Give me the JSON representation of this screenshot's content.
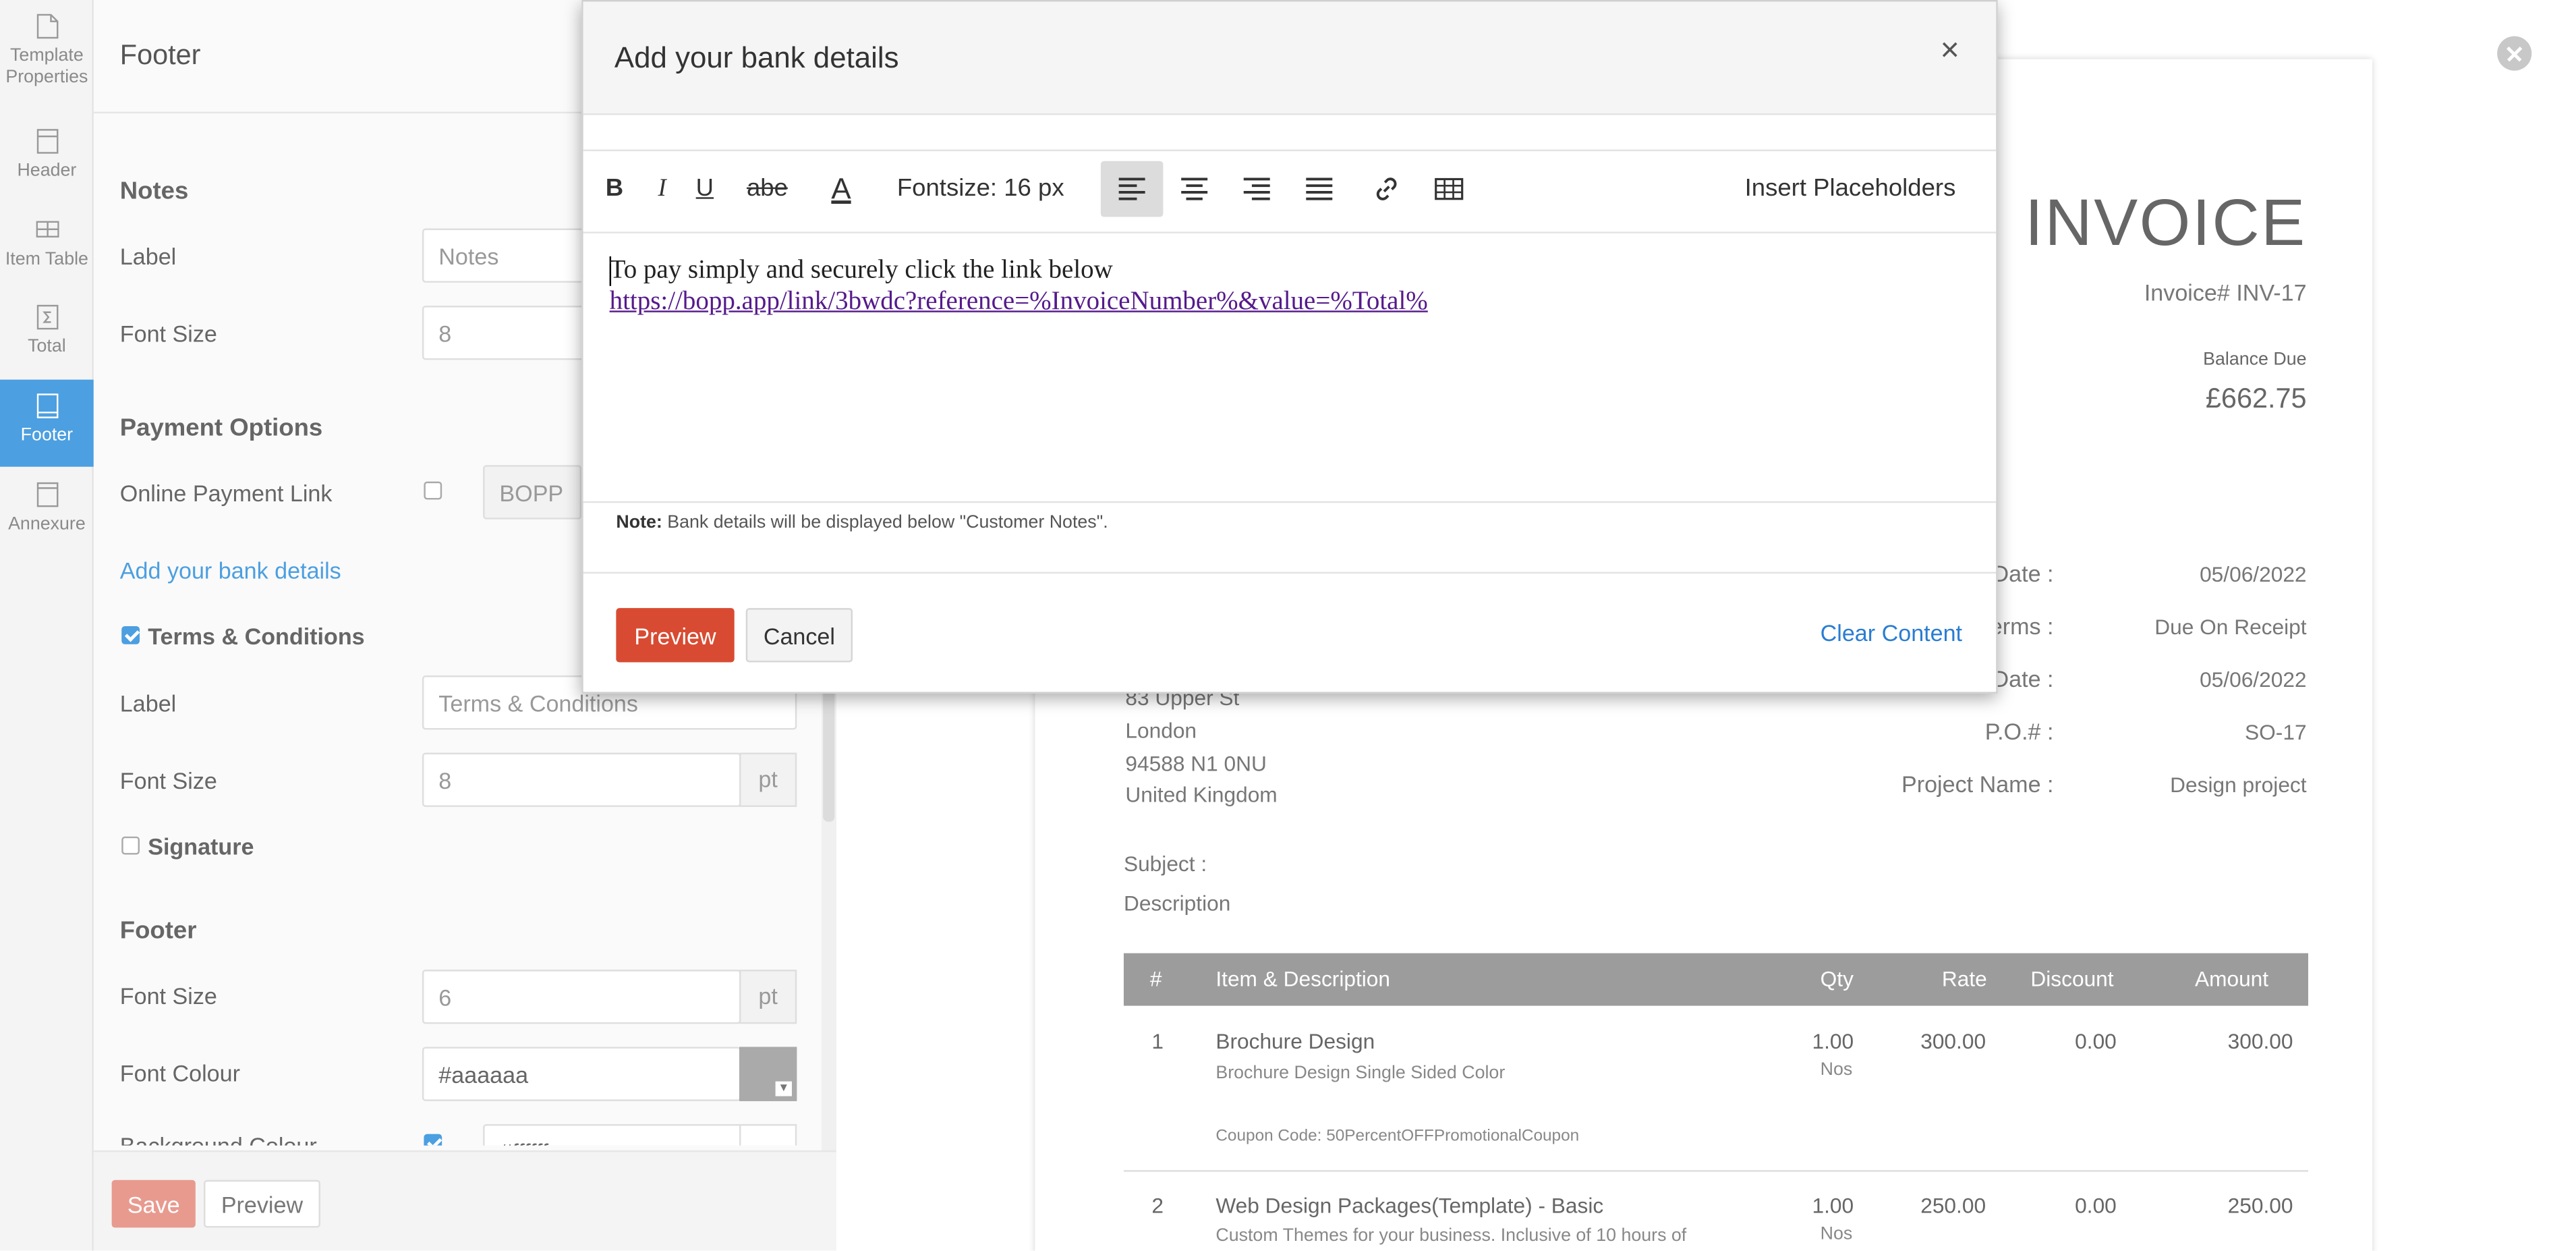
{
  "rail": {
    "items": [
      {
        "label": "Template Properties",
        "icon": "template-properties-icon"
      },
      {
        "label": "Header",
        "icon": "header-icon"
      },
      {
        "label": "Item Table",
        "icon": "item-table-icon"
      },
      {
        "label": "Total",
        "icon": "total-icon"
      },
      {
        "label": "Footer",
        "icon": "footer-icon"
      },
      {
        "label": "Annexure",
        "icon": "annexure-icon"
      }
    ],
    "line1": "Template",
    "line2": "Properties",
    "active": "Footer"
  },
  "panel": {
    "title": "Footer",
    "notes": {
      "title": "Notes",
      "label_caption": "Label",
      "label_value": "Notes",
      "font_size_caption": "Font Size",
      "font_size_value": "8"
    },
    "payment": {
      "title": "Payment Options",
      "online_caption": "Online Payment Link",
      "online_checked": false,
      "online_value": "BOPP",
      "bank_link": "Add your bank details"
    },
    "terms": {
      "checkbox_label": "Terms & Conditions",
      "checked": true,
      "label_caption": "Label",
      "label_value": "Terms & Conditions",
      "font_size_caption": "Font Size",
      "font_size_value": "8",
      "unit": "pt"
    },
    "signature": {
      "checkbox_label": "Signature",
      "checked": false
    },
    "footer": {
      "title": "Footer",
      "font_size_caption": "Font Size",
      "font_size_value": "6",
      "unit": "pt",
      "font_colour_caption": "Font Colour",
      "font_colour_value": "#aaaaaa",
      "background_caption": "Background Colour",
      "background_checked": true,
      "background_value": "#ffffff"
    },
    "save_label": "Save",
    "preview_label": "Preview"
  },
  "invoice": {
    "title": "INVOICE",
    "number": "Invoice# INV-17",
    "balance_label": "Balance Due",
    "balance_value": "£662.75",
    "meta": [
      {
        "label": "Date :",
        "value": "05/06/2022"
      },
      {
        "label": "erms :",
        "value": "Due On Receipt"
      },
      {
        "label": "Date :",
        "value": "05/06/2022"
      },
      {
        "label": "P.O.# :",
        "value": "SO-17"
      },
      {
        "label": "Project Name :",
        "value": "Design project"
      }
    ],
    "address": [
      "83 Upper St",
      "London",
      "94588 N1 0NU",
      "United Kingdom"
    ],
    "subject_label": "Subject :",
    "description_label": "Description",
    "columns": [
      "#",
      "Item & Description",
      "Qty",
      "Rate",
      "Discount",
      "Amount"
    ],
    "rows": [
      {
        "num": "1",
        "item": "Brochure Design",
        "desc": "Brochure Design Single Sided Color",
        "extra": "Coupon Code: 50PercentOFFPromotionalCoupon",
        "qty": "1.00",
        "unit": "Nos",
        "rate": "300.00",
        "discount": "0.00",
        "amount": "300.00"
      },
      {
        "num": "2",
        "item": "Web Design Packages(Template) - Basic",
        "desc": "Custom Themes for your business. Inclusive of 10 hours of",
        "qty": "1.00",
        "unit": "Nos",
        "rate": "250.00",
        "discount": "0.00",
        "amount": "250.00"
      }
    ]
  },
  "modal": {
    "title": "Add your bank details",
    "close_glyph": "×",
    "toolbar": {
      "bold": "B",
      "italic": "I",
      "underline": "U",
      "strike": "abe",
      "font_color": "A",
      "fontsize": "Fontsize: 16 px",
      "placeholders": "Insert Placeholders"
    },
    "content_line1": "To pay simply and securely click the link below",
    "content_link": "https://bopp.app/link/3bwdc?reference=%InvoiceNumber%&value=%Total%",
    "note_bold": "Note:",
    "note_text": " Bank details will be displayed below \"Customer Notes\".",
    "preview_label": "Preview",
    "cancel_label": "Cancel",
    "clear_label": "Clear Content"
  },
  "colors": {
    "accent": "#4c9fe0",
    "danger": "#d84b32",
    "link": "#2a7dd1"
  }
}
